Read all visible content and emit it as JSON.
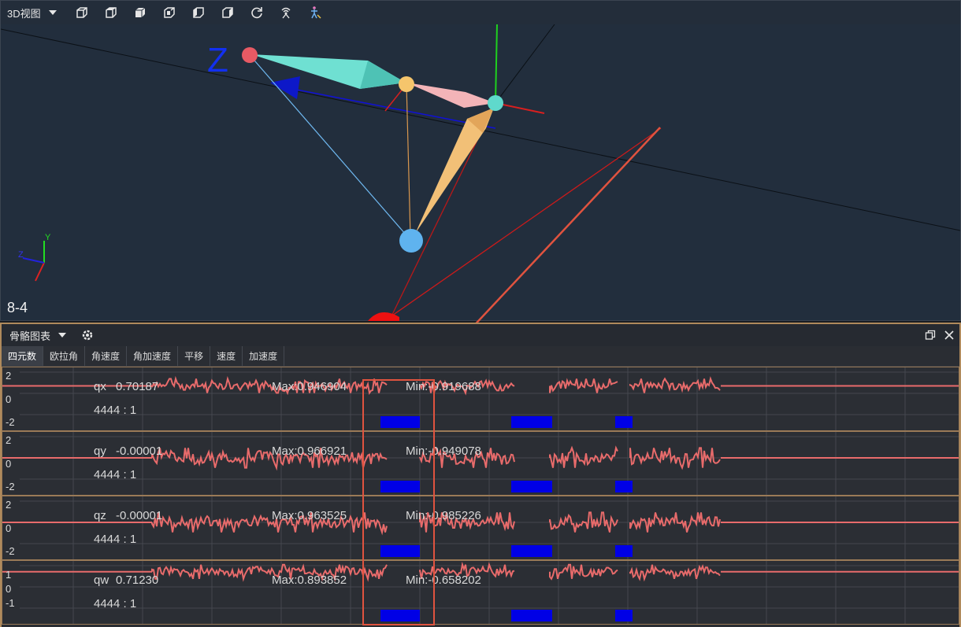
{
  "viewer": {
    "view_mode": "3D视图",
    "toolbar_icons": [
      "cube-front-icon",
      "cube-top-icon",
      "cube-solid-icon",
      "cube-iso-icon",
      "cube-side-icon",
      "cube-back-icon",
      "refresh-icon",
      "antenna-icon",
      "skeleton-icon"
    ],
    "axis_z_label": "Z",
    "mini_axis": {
      "y": "Y",
      "z": "Z"
    },
    "frame_label": "8-4",
    "colors": {
      "bg": "#222e3d",
      "bone_cyan": "#6fe0d2",
      "bone_pink": "#f3b4b8",
      "bone_orange": "#f2c077",
      "joint_blue": "#5fb3ef",
      "annotation_red": "#e0533f"
    }
  },
  "chart_panel": {
    "title": "骨骼图表",
    "tabs": [
      "四元数",
      "欧拉角",
      "角速度",
      "角加速度",
      "平移",
      "速度",
      "加速度"
    ],
    "active_tab": 0,
    "charts": [
      {
        "name": "qx",
        "value": "0.70187",
        "max": "Max:0.946904",
        "min": "Min:-0.919688",
        "frame": "4444 : 1",
        "yticks": [
          "2",
          "0",
          "-2"
        ],
        "baseline": 0.70187,
        "scale": 2
      },
      {
        "name": "qy",
        "value": "-0.00001",
        "max": "Max:0.966921",
        "min": "Min:-0.949078",
        "frame": "4444 : 1",
        "yticks": [
          "2",
          "0",
          "-2"
        ],
        "baseline": 0.0,
        "scale": 2
      },
      {
        "name": "qz",
        "value": "-0.00001",
        "max": "Max:0.963525",
        "min": "Min:-0.985226",
        "frame": "4444 : 1",
        "yticks": [
          "2",
          "0",
          "-2"
        ],
        "baseline": 0.0,
        "scale": 2
      },
      {
        "name": "qw",
        "value": "0.71230",
        "max": "Max:0.893852",
        "min": "Min:-0.658202",
        "frame": "4444 : 1",
        "yticks": [
          "1",
          "0",
          "-1"
        ],
        "baseline": 0.7123,
        "scale": 1
      }
    ],
    "series_color": "#e86b6b",
    "marker_color": "#0000e6"
  }
}
